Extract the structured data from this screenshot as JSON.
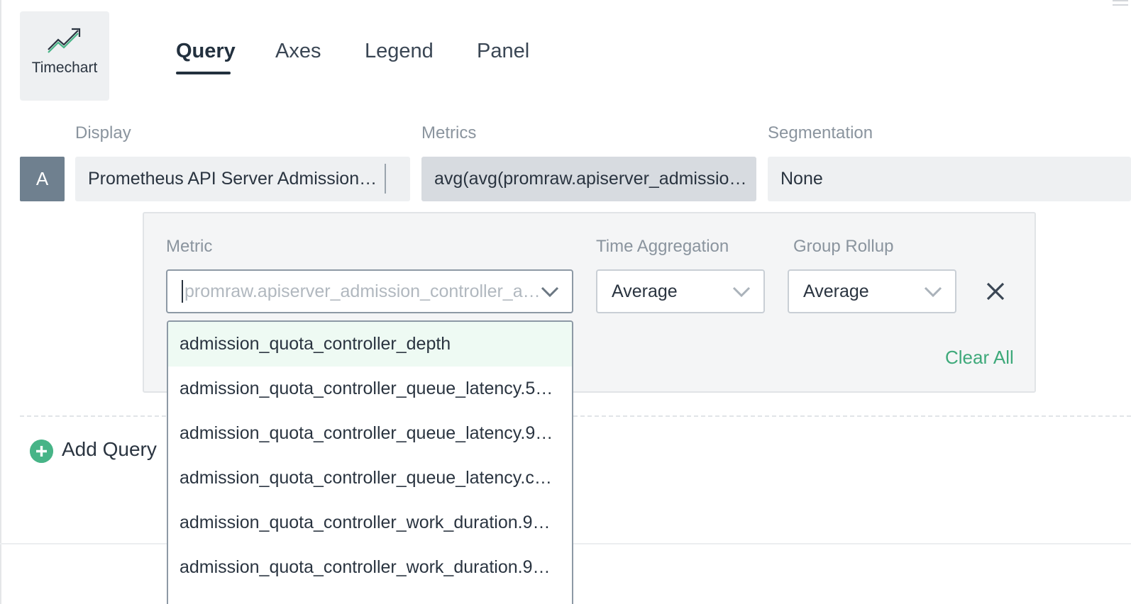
{
  "chart_type": {
    "label": "Timechart",
    "icon": "trend-up-icon"
  },
  "tabs": [
    {
      "label": "Query",
      "active": true
    },
    {
      "label": "Axes",
      "active": false
    },
    {
      "label": "Legend",
      "active": false
    },
    {
      "label": "Panel",
      "active": false
    }
  ],
  "columns": {
    "display": "Display",
    "metrics": "Metrics",
    "segmentation": "Segmentation"
  },
  "query": {
    "letter": "A",
    "display_value": "Prometheus API Server Admission…",
    "metrics_value": "avg(avg(promraw.apiserver_admissio…",
    "segmentation_value": "None"
  },
  "editor": {
    "metric_label": "Metric",
    "metric_placeholder": "promraw.apiserver_admission_controller_a…",
    "time_aggregation_label": "Time Aggregation",
    "time_aggregation_value": "Average",
    "group_rollup_label": "Group Rollup",
    "group_rollup_value": "Average",
    "clear_all": "Clear All"
  },
  "dropdown_items": [
    "admission_quota_controller_depth",
    "admission_quota_controller_queue_latency.5…",
    "admission_quota_controller_queue_latency.9…",
    "admission_quota_controller_queue_latency.c…",
    "admission_quota_controller_work_duration.9…",
    "admission_quota_controller_work_duration.9…"
  ],
  "add_query": "Add Query",
  "colors": {
    "accent": "#47b487",
    "tab_active": "#22303e",
    "query_letter_bg": "#6f808f"
  }
}
